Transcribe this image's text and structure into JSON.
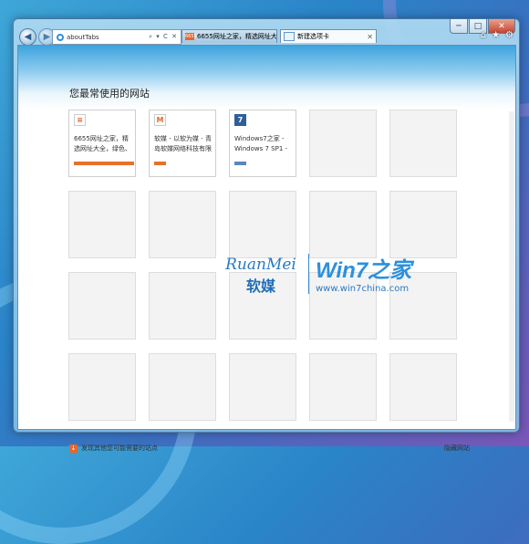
{
  "browser": {
    "address": "aboutTabs",
    "address_tools": "⌕ ▾ C ✕",
    "tabs": [
      {
        "label": "6655网址之家，精选网址大全...",
        "favicon_text": "6655"
      },
      {
        "label": "新建选项卡"
      }
    ],
    "caption": {
      "minimize": "─",
      "maximize": "□",
      "close": "✕"
    },
    "right_tools": {
      "home": "⌂",
      "favorites": "★",
      "settings": "⚙"
    }
  },
  "newtab": {
    "heading": "您最常使用的网站",
    "tiles": [
      {
        "title": "6655网址之家，精选网址大全，绿色、安...",
        "icon_char": "≡",
        "icon_color": "#e8662a",
        "bar_color": "#e8702a",
        "bar_fraction": 1.0
      },
      {
        "title": "软媒 - 以软为媒 - 青岛软媒网络科技有限公司",
        "icon_char": "M",
        "icon_color": "#e8662a",
        "bar_color": "#e8702a",
        "bar_fraction": 0.2
      },
      {
        "title": "Windows7之家 - Windows 7 SP1 - W...",
        "icon_char": "7",
        "icon_color": "#2e5f99",
        "bar_color": "#5b86c0",
        "bar_fraction": 0.2
      }
    ],
    "footer_left": "发现其他您可能需要的站点",
    "footer_right": "隐藏网站"
  },
  "watermark": {
    "brand": "RuanMei",
    "brand_cn": "软媒",
    "title": "Win7之家",
    "url": "www.win7china.com"
  }
}
